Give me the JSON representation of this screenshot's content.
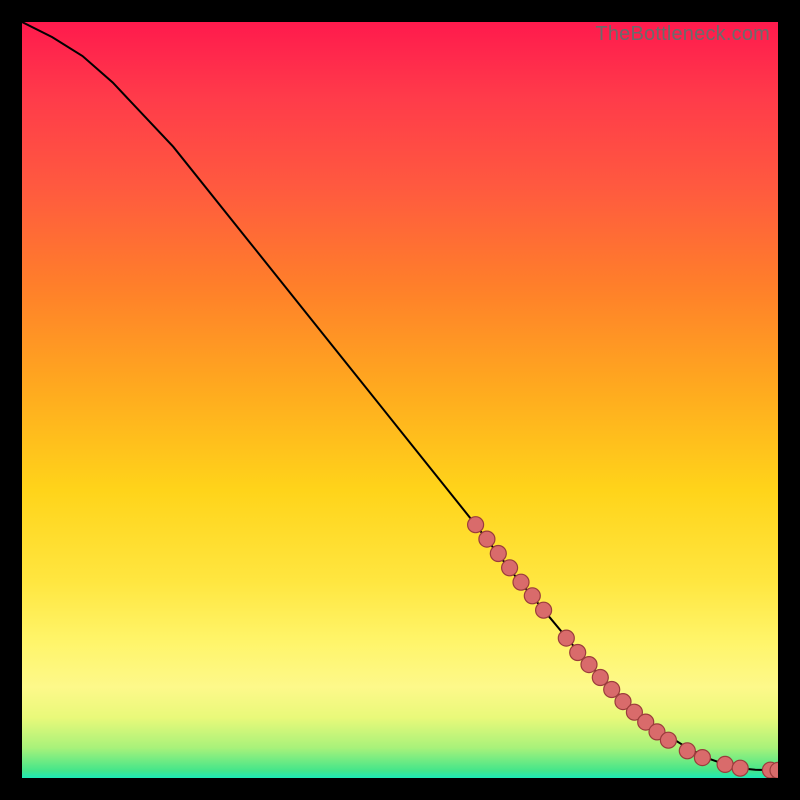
{
  "watermark": {
    "text": "TheBottleneck.com"
  },
  "colors": {
    "point_fill": "#d96b6b",
    "point_stroke": "#9b3c3c",
    "curve": "#000000"
  },
  "chart_data": {
    "type": "line",
    "title": "",
    "xlabel": "",
    "ylabel": "",
    "xlim": [
      0,
      100
    ],
    "ylim": [
      0,
      100
    ],
    "curve": {
      "x": [
        0,
        4,
        8,
        12,
        20,
        30,
        40,
        50,
        60,
        65,
        70,
        75,
        80,
        84,
        88,
        91,
        93,
        95,
        97,
        100
      ],
      "y": [
        100,
        98,
        95.5,
        92,
        83.5,
        71,
        58.5,
        46,
        33.5,
        27,
        21,
        15,
        10,
        6.5,
        4,
        2.5,
        1.8,
        1.3,
        1.1,
        1.0
      ]
    },
    "series": [
      {
        "name": "points",
        "x": [
          60,
          61.5,
          63,
          64.5,
          66,
          67.5,
          69,
          72,
          73.5,
          75,
          76.5,
          78,
          79.5,
          81,
          82.5,
          84,
          85.5,
          88,
          90,
          93,
          95,
          99,
          100
        ],
        "y": [
          33.5,
          31.6,
          29.7,
          27.8,
          25.9,
          24.1,
          22.2,
          18.5,
          16.6,
          15.0,
          13.3,
          11.7,
          10.1,
          8.7,
          7.4,
          6.1,
          5.0,
          3.6,
          2.7,
          1.8,
          1.3,
          1.05,
          1.0
        ]
      }
    ]
  }
}
